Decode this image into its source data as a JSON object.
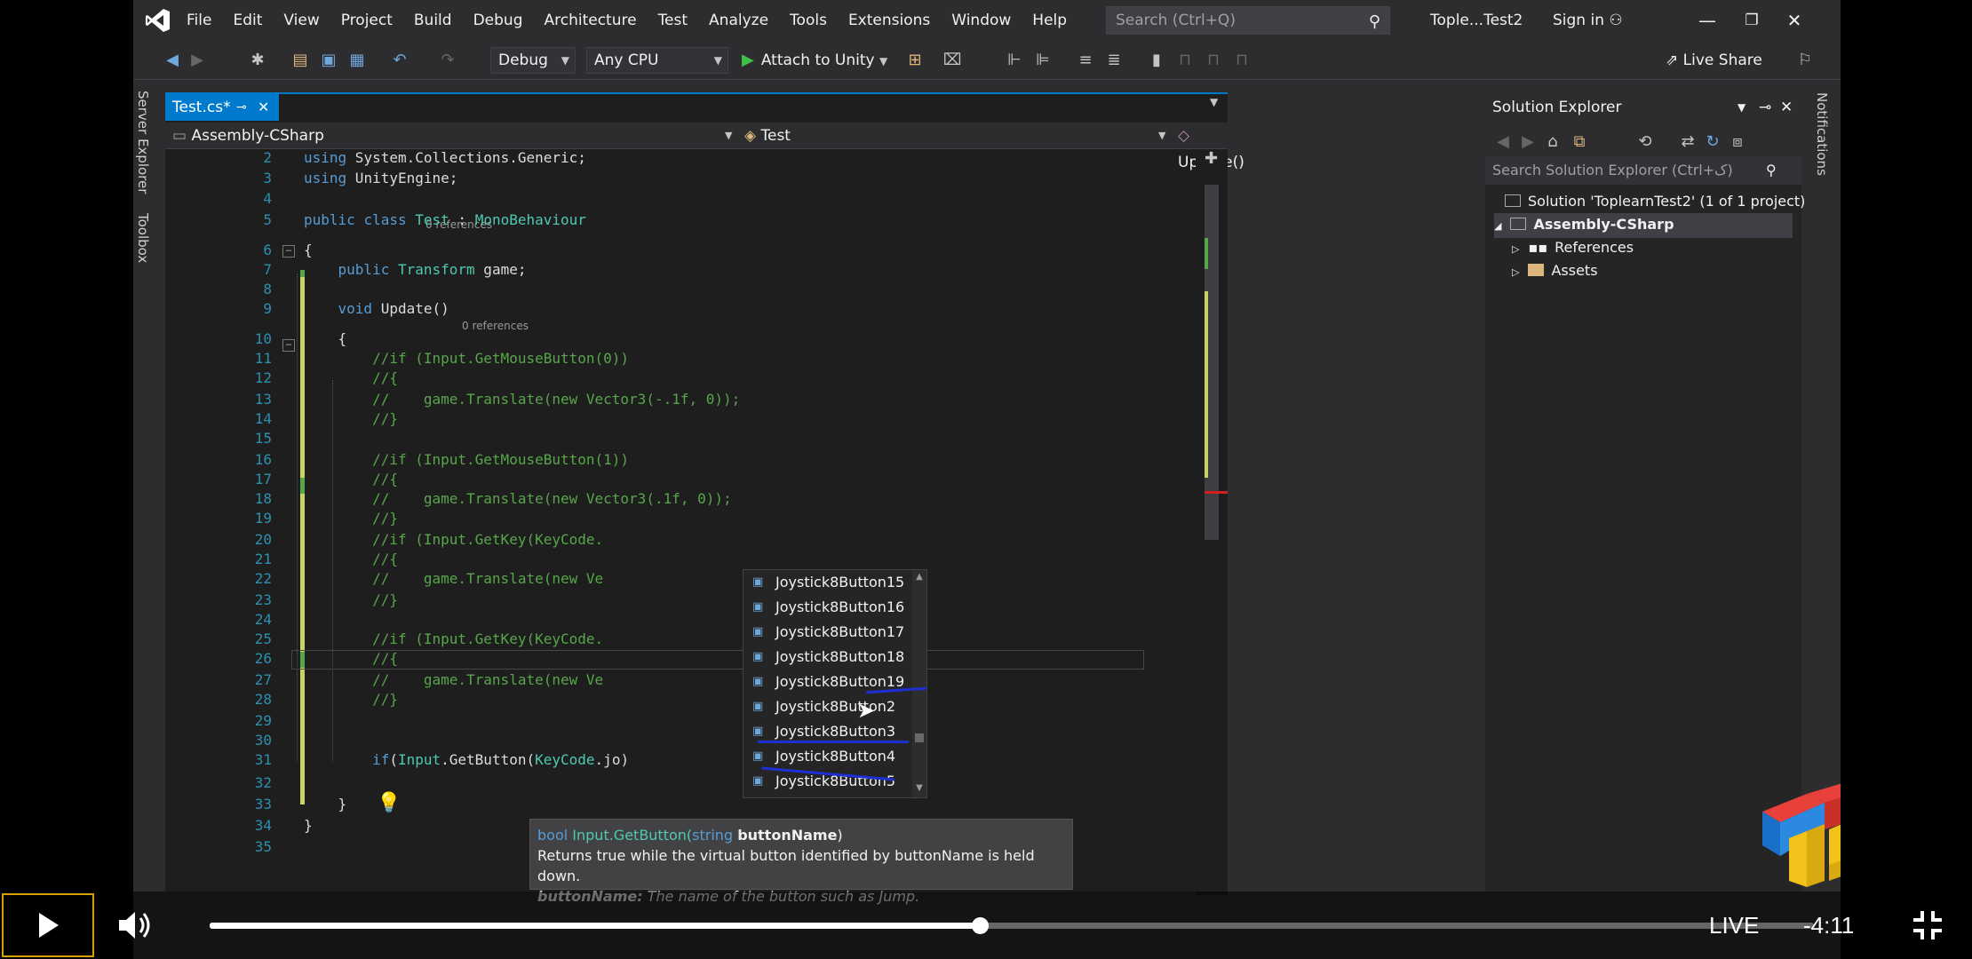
{
  "menu": [
    "File",
    "Edit",
    "View",
    "Project",
    "Build",
    "Debug",
    "Architecture",
    "Test",
    "Analyze",
    "Tools",
    "Extensions",
    "Window",
    "Help"
  ],
  "search": {
    "placeholder": "Search (Ctrl+Q)"
  },
  "window": {
    "solution_title": "Tople...Test2",
    "signin": "Sign in"
  },
  "toolbar": {
    "config": "Debug",
    "platform": "Any CPU",
    "attach_label": "Attach to Unity",
    "liveshare_label": "Live Share"
  },
  "left_tabs": [
    "Server Explorer",
    "Toolbox"
  ],
  "right_tabs": [
    "Notifications"
  ],
  "editor": {
    "tab_title": "Test.cs*",
    "nav": {
      "project": "Assembly-CSharp",
      "class": "Test",
      "member": "Update()"
    },
    "refs_label": "0 references",
    "lines": [
      {
        "n": "2",
        "text": "using System.Collections.Generic;"
      },
      {
        "n": "3",
        "text": "using UnityEngine;"
      },
      {
        "n": "4",
        "text": ""
      },
      {
        "n": "5",
        "text": "public class Test : MonoBehaviour"
      },
      {
        "n": "6",
        "text": "{"
      },
      {
        "n": "7",
        "text": "    public Transform game;"
      },
      {
        "n": "8",
        "text": ""
      },
      {
        "n": "9",
        "text": "    void Update()"
      },
      {
        "n": "10",
        "text": "    {"
      },
      {
        "n": "11",
        "text": "        //if (Input.GetMouseButton(0))"
      },
      {
        "n": "12",
        "text": "        //{"
      },
      {
        "n": "13",
        "text": "        //    game.Translate(new Vector3(-.1f, 0));"
      },
      {
        "n": "14",
        "text": "        //}"
      },
      {
        "n": "15",
        "text": ""
      },
      {
        "n": "16",
        "text": "        //if (Input.GetMouseButton(1))"
      },
      {
        "n": "17",
        "text": "        //{"
      },
      {
        "n": "18",
        "text": "        //    game.Translate(new Vector3(.1f, 0));"
      },
      {
        "n": "19",
        "text": "        //}"
      },
      {
        "n": "20",
        "text": "        //if (Input.GetKey(KeyCode."
      },
      {
        "n": "21",
        "text": "        //{"
      },
      {
        "n": "22",
        "text": "        //    game.Translate(new Ve"
      },
      {
        "n": "23",
        "text": "        //}"
      },
      {
        "n": "24",
        "text": ""
      },
      {
        "n": "25",
        "text": "        //if (Input.GetKey(KeyCode."
      },
      {
        "n": "26",
        "text": "        //{"
      },
      {
        "n": "27",
        "text": "        //    game.Translate(new Ve"
      },
      {
        "n": "28",
        "text": "        //}"
      },
      {
        "n": "29",
        "text": ""
      },
      {
        "n": "30",
        "text": ""
      },
      {
        "n": "31",
        "text": "        if(Input.GetButton(KeyCode.jo)"
      },
      {
        "n": "32",
        "text": ""
      },
      {
        "n": "33",
        "text": "    }"
      },
      {
        "n": "34",
        "text": "}"
      },
      {
        "n": "35",
        "text": ""
      }
    ]
  },
  "completion": {
    "items": [
      "Joystick8Button15",
      "Joystick8Button16",
      "Joystick8Button17",
      "Joystick8Button18",
      "Joystick8Button19",
      "Joystick8Button2",
      "Joystick8Button3",
      "Joystick8Button4",
      "Joystick8Button5"
    ]
  },
  "tooltip": {
    "sig_return": "bool",
    "sig_method": "Input.GetButton(",
    "sig_param_type": "string",
    "sig_param_name": "buttonName",
    "sig_close": ")",
    "description": "Returns true while the virtual button identified by buttonName is held down.",
    "param_label": "buttonName:",
    "param_desc": "The name of the button such as Jump."
  },
  "solution_explorer": {
    "title": "Solution Explorer",
    "search_placeholder": "Search Solution Explorer (Ctrl+ک)",
    "solution": "Solution 'ToplearnTest2' (1 of 1 project)",
    "project": "Assembly-CSharp",
    "children": [
      "References",
      "Assets"
    ]
  },
  "player": {
    "live_label": "LIVE",
    "time_remaining": "-4:11",
    "progress": 0.48
  }
}
